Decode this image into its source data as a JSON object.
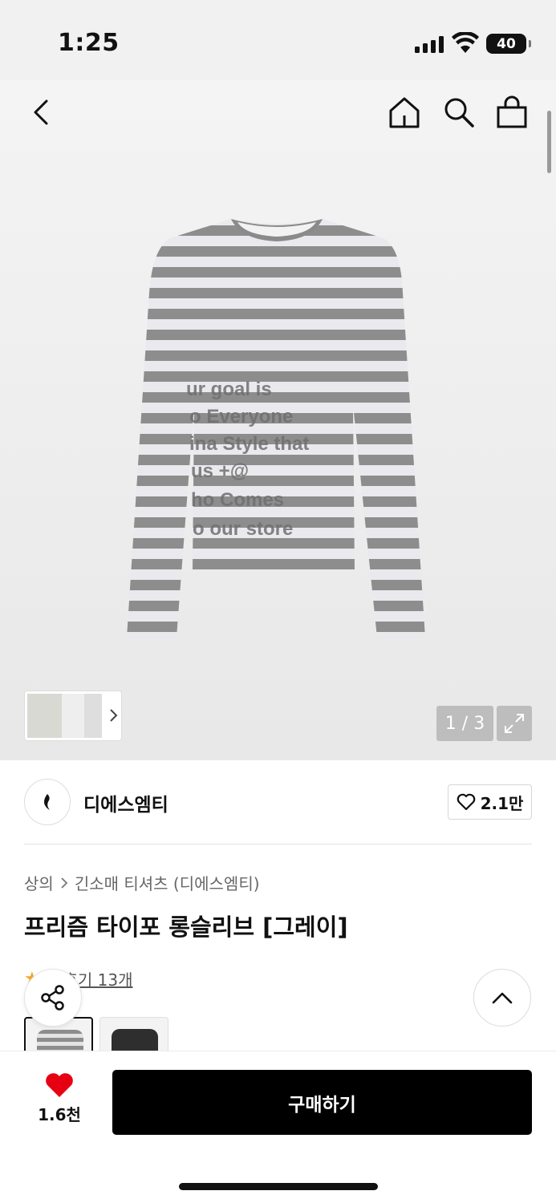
{
  "status_bar": {
    "time": "1:25",
    "battery": "40"
  },
  "gallery": {
    "counter": "1 / 3",
    "shirt_print_lines": [
      "ur goal is",
      "o Everyone",
      "ina Style that",
      "us +@",
      "ho Comes",
      "o our store"
    ]
  },
  "brand": {
    "name": "디에스엠티",
    "like_count": "2.1만"
  },
  "breadcrumb": {
    "category": "상의",
    "subcategory": "긴소매 티셔츠 (디에스엠티)"
  },
  "product": {
    "title": "프리즘 타이포 롱슬리브 [그레이]",
    "rating_value": "5",
    "reviews_label": "후기 13개"
  },
  "bottom_bar": {
    "wish_count": "1.6천",
    "buy_label": "구매하기"
  },
  "colors": {
    "accent_red": "#e60012",
    "star": "#f5a623",
    "buy_button": "#000000"
  },
  "icons": [
    "back-icon",
    "home-icon",
    "search-icon",
    "bag-icon",
    "expand-icon",
    "heart-outline-icon",
    "chevron-right-icon",
    "share-icon",
    "chevron-up-icon",
    "heart-filled-icon"
  ]
}
